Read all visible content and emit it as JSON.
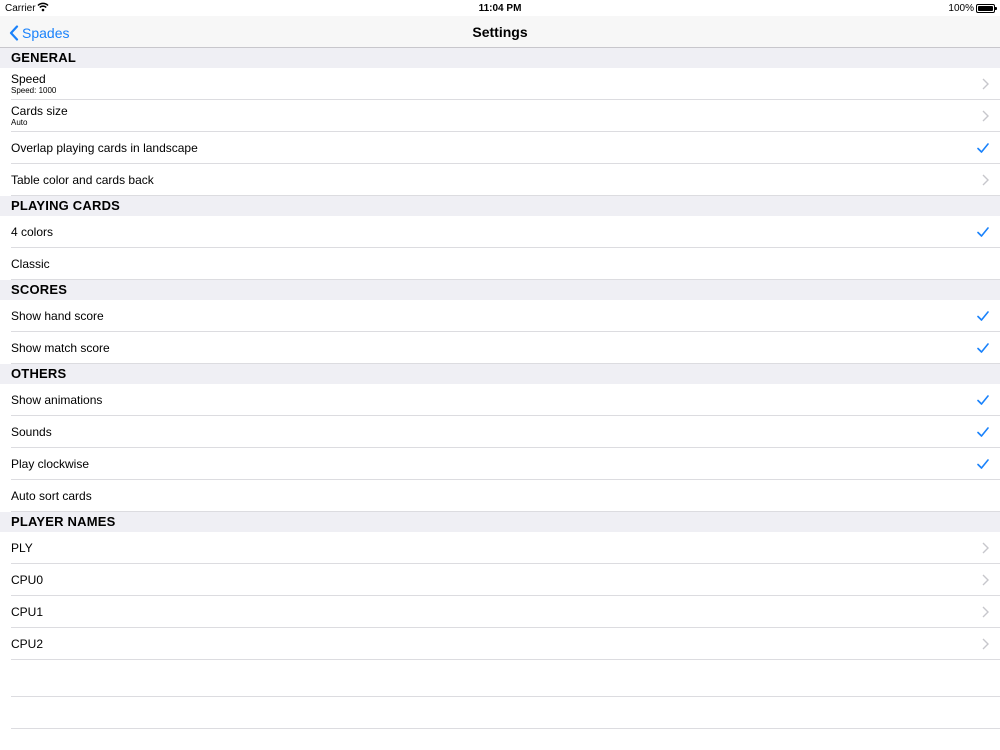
{
  "status_bar": {
    "carrier": "Carrier",
    "time": "11:04 PM",
    "battery": "100%"
  },
  "nav": {
    "back_label": "Spades",
    "title": "Settings"
  },
  "sections": {
    "general": {
      "header": "GENERAL",
      "speed": {
        "title": "Speed",
        "subtitle": "Speed: 1000"
      },
      "cards_size": {
        "title": "Cards size",
        "subtitle": "Auto"
      },
      "overlap": {
        "title": "Overlap playing cards in landscape",
        "checked": true
      },
      "table_color": {
        "title": "Table color and cards back"
      }
    },
    "playing_cards": {
      "header": "PLAYING CARDS",
      "four_colors": {
        "title": "4 colors",
        "checked": true
      },
      "classic": {
        "title": "Classic",
        "checked": false
      }
    },
    "scores": {
      "header": "SCORES",
      "hand_score": {
        "title": "Show hand score",
        "checked": true
      },
      "match_score": {
        "title": "Show match score",
        "checked": true
      }
    },
    "others": {
      "header": "OTHERS",
      "animations": {
        "title": "Show animations",
        "checked": true
      },
      "sounds": {
        "title": "Sounds",
        "checked": true
      },
      "clockwise": {
        "title": "Play clockwise",
        "checked": true
      },
      "auto_sort": {
        "title": "Auto sort cards",
        "checked": false
      }
    },
    "player_names": {
      "header": "PLAYER NAMES",
      "players": [
        "PLY",
        "CPU0",
        "CPU1",
        "CPU2"
      ]
    }
  },
  "colors": {
    "accent": "#1a82fb",
    "section_bg": "#efeff4",
    "separator": "#dcdce0",
    "chevron": "#c7c7cc"
  }
}
